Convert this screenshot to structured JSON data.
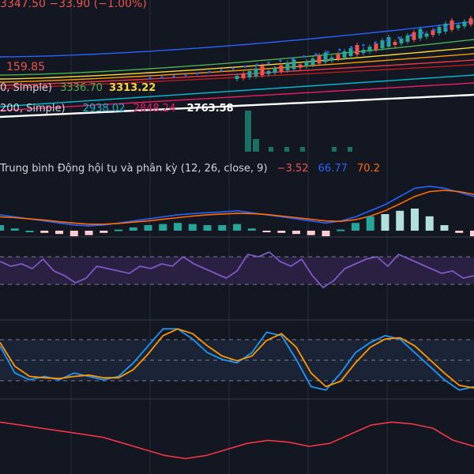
{
  "header": {
    "price_line": "3347.50 −33.90 (−1.00%)"
  },
  "ma_legend": {
    "price_1159": "159.85",
    "row2_prefix": "0, Simple)",
    "row2_val_a": "3336.70",
    "row2_val_b": "3313.22",
    "row3_prefix": "200, Simple)",
    "row3_val_a": "2938.02",
    "row3_val_b": "2848.24",
    "row3_val_c": "2763.58"
  },
  "macd_legend": {
    "title": "Trung bình Động hội tụ và phân kỳ (12, 26, close, 9)",
    "hist": "−3.52",
    "macd": "66.77",
    "signal": "70.2"
  },
  "colors": {
    "background": "#131722",
    "grid": "#2a2e39",
    "up": "#26a69a",
    "down": "#ef5350",
    "macd_line": "#2962ff",
    "signal_line": "#ff6d00",
    "rsi_line": "#7e57c2",
    "stoch_k": "#2196f3",
    "stoch_d": "#ff9800",
    "bottom_line": "#f23645"
  },
  "chart_data": {
    "type": "line",
    "panes": [
      {
        "name": "price",
        "series": [
          {
            "role": "moving-average",
            "color": "#2962ff"
          },
          {
            "role": "moving-average",
            "color": "#4caf50"
          },
          {
            "role": "moving-average",
            "color": "#fdd835"
          },
          {
            "role": "moving-average",
            "color": "#ff9800"
          },
          {
            "role": "moving-average",
            "color": "#f23645"
          },
          {
            "role": "moving-average",
            "color": "#b71c1c"
          },
          {
            "role": "moving-average",
            "color": "#00bcd4"
          },
          {
            "role": "moving-average",
            "color": "#e91e63"
          },
          {
            "role": "moving-average",
            "color": "#ffffff"
          }
        ]
      },
      {
        "name": "macd",
        "macd": [
          0.15,
          0.1,
          0.05,
          0.0,
          -0.05,
          -0.1,
          -0.12,
          -0.1,
          -0.05,
          0.0,
          0.05,
          0.1,
          0.15,
          0.18,
          0.2,
          0.22,
          0.25,
          0.2,
          0.15,
          0.1,
          0.05,
          0.0,
          -0.05,
          0.0,
          0.1,
          0.25,
          0.4,
          0.6,
          0.8,
          0.85,
          0.8,
          0.7,
          0.6
        ],
        "signal": [
          0.1,
          0.08,
          0.05,
          0.02,
          -0.02,
          -0.05,
          -0.08,
          -0.08,
          -0.06,
          -0.03,
          0.0,
          0.04,
          0.08,
          0.12,
          0.15,
          0.17,
          0.19,
          0.18,
          0.16,
          0.12,
          0.08,
          0.04,
          0.0,
          -0.01,
          0.03,
          0.12,
          0.25,
          0.42,
          0.6,
          0.72,
          0.75,
          0.72,
          0.65
        ]
      },
      {
        "name": "rsi",
        "values": [
          0.65,
          0.55,
          0.6,
          0.5,
          0.7,
          0.45,
          0.35,
          0.2,
          0.3,
          0.55,
          0.5,
          0.45,
          0.4,
          0.55,
          0.5,
          0.6,
          0.55,
          0.75,
          0.6,
          0.5,
          0.4,
          0.3,
          0.45,
          0.8,
          0.75,
          0.85,
          0.65,
          0.55,
          0.7,
          0.35,
          0.1,
          0.25,
          0.5,
          0.6,
          0.7,
          0.75,
          0.55,
          0.8,
          0.7,
          0.6,
          0.5,
          0.4,
          0.45,
          0.3,
          0.35
        ]
      },
      {
        "name": "stochastic",
        "k": [
          0.7,
          0.3,
          0.2,
          0.25,
          0.2,
          0.3,
          0.25,
          0.2,
          0.25,
          0.45,
          0.7,
          0.95,
          0.95,
          0.8,
          0.6,
          0.5,
          0.45,
          0.6,
          0.9,
          0.85,
          0.5,
          0.1,
          0.05,
          0.3,
          0.6,
          0.75,
          0.85,
          0.8,
          0.6,
          0.4,
          0.2,
          0.05,
          0.1
        ],
        "d": [
          0.75,
          0.4,
          0.25,
          0.23,
          0.22,
          0.25,
          0.27,
          0.23,
          0.23,
          0.35,
          0.58,
          0.85,
          0.95,
          0.88,
          0.7,
          0.55,
          0.48,
          0.55,
          0.78,
          0.88,
          0.68,
          0.3,
          0.1,
          0.18,
          0.45,
          0.68,
          0.8,
          0.82,
          0.7,
          0.5,
          0.3,
          0.12,
          0.08
        ]
      },
      {
        "name": "lower-indicator",
        "values": [
          0.75,
          0.7,
          0.65,
          0.6,
          0.55,
          0.5,
          0.4,
          0.3,
          0.2,
          0.15,
          0.2,
          0.3,
          0.4,
          0.45,
          0.42,
          0.35,
          0.4,
          0.55,
          0.7,
          0.75,
          0.72,
          0.65,
          0.45,
          0.35
        ]
      }
    ]
  }
}
